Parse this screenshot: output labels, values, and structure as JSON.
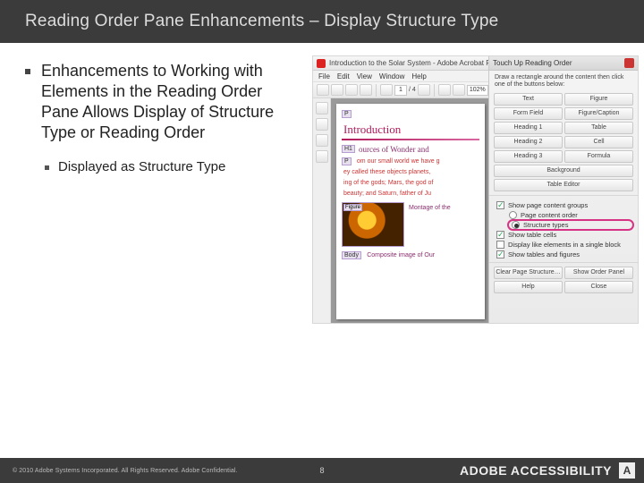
{
  "title": "Reading Order Pane Enhancements – Display Structure Type",
  "bullets": {
    "main": "Enhancements to Working with Elements in the Reading Order Pane Allows Display of Structure Type or Reading Order",
    "sub": "Displayed as Structure Type"
  },
  "screenshot": {
    "app_title": "Introduction to the Solar System - Adobe Acrobat Pro",
    "menus": [
      "File",
      "Edit",
      "View",
      "Window",
      "Help"
    ],
    "page_field": "1",
    "page_total": "/ 4",
    "zoom": "102%",
    "doc": {
      "tag_p": "P",
      "heading": "Introduction",
      "tag_h1": "H1",
      "subheading": "ources of Wonder and",
      "tag_para": "P",
      "para1": "om our small world we have g",
      "para2": "ey called these objects planets,",
      "para3": "ing of the gods; Mars, the god of",
      "para4": "beauty; and Saturn, father of Ju",
      "fig_tag": "Figure",
      "fig_caption": "Montage of the",
      "body_tag": "Body",
      "body_caption": "Composite image of Our"
    },
    "panel": {
      "title": "Touch Up Reading Order",
      "instruction": "Draw a rectangle around the content then click one of the buttons below:",
      "buttons": {
        "text": "Text",
        "figure": "Figure",
        "formfield": "Form Field",
        "figcap": "Figure/Caption",
        "h1": "Heading 1",
        "table": "Table",
        "h2": "Heading 2",
        "cell": "Cell",
        "h3": "Heading 3",
        "formula": "Formula",
        "background": "Background",
        "tableeditor": "Table Editor"
      },
      "options": {
        "show_groups": "Show page content groups",
        "order": "Page content order",
        "types": "Structure types",
        "table_cells": "Show table cells",
        "like_block": "Display like elements in a single block",
        "tables_figs": "Show tables and figures"
      },
      "footer_buttons": {
        "clear": "Clear Page Structure…",
        "showpanel": "Show Order Panel",
        "help": "Help",
        "close": "Close"
      }
    }
  },
  "footer": {
    "copyright": "© 2010 Adobe Systems Incorporated.  All Rights Reserved.  Adobe Confidential.",
    "page": "8",
    "brand": "ADOBE ACCESSIBILITY",
    "logo": "A"
  }
}
